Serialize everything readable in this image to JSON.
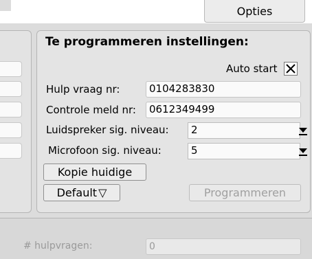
{
  "tabs": {
    "options_label": "Opties"
  },
  "panel": {
    "title": "Te programmeren instellingen:",
    "auto_start": {
      "label": "Auto start",
      "checked": true,
      "mark": "✗"
    },
    "help_number": {
      "label": "Hulp vraag nr:",
      "value": "0104283830"
    },
    "control_number": {
      "label": "Controle meld nr:",
      "value": "0612349499"
    },
    "speaker_level": {
      "label": "Luidspreker sig. niveau:",
      "value": "2"
    },
    "mic_level": {
      "label": "Microfoon sig. niveau:",
      "value": "5"
    },
    "copy_button": "Kopie huidige",
    "default_button": "Default",
    "default_arrow": "▽",
    "program_button": "Programmeren"
  },
  "bottom": {
    "help_requests_label": "# hulpvragen:",
    "help_requests_value": "0"
  },
  "icons": [
    "chevron-down-icon",
    "checkbox-check-icon"
  ]
}
